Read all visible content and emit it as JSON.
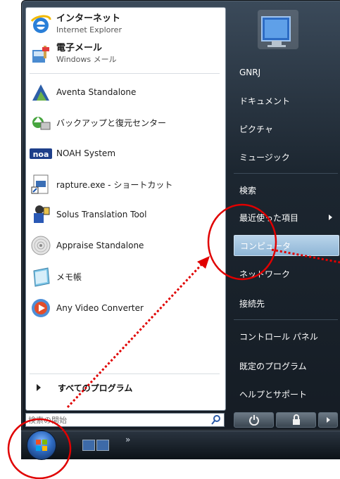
{
  "programs": [
    {
      "id": "ie",
      "main": "インターネット",
      "sub": "Internet Explorer"
    },
    {
      "id": "mail",
      "main": "電子メール",
      "sub": "Windows メール"
    },
    {
      "id": "aventa",
      "label": "Aventa Standalone"
    },
    {
      "id": "backup",
      "label": "バックアップと復元センター"
    },
    {
      "id": "noah",
      "label": "NOAH System"
    },
    {
      "id": "rapture",
      "label": "rapture.exe - ショートカット"
    },
    {
      "id": "solus",
      "label": "Solus Translation Tool"
    },
    {
      "id": "appraise",
      "label": "Appraise Standalone"
    },
    {
      "id": "notepad",
      "label": "メモ帳"
    },
    {
      "id": "avc",
      "label": "Any Video Converter"
    }
  ],
  "all_programs": "すべてのプログラム",
  "search": {
    "placeholder": "検索の開始"
  },
  "right_items": [
    {
      "id": "user",
      "label": "GNRJ"
    },
    {
      "id": "documents",
      "label": "ドキュメント"
    },
    {
      "id": "pictures",
      "label": "ピクチャ"
    },
    {
      "id": "music",
      "label": "ミュージック"
    },
    {
      "id": "search",
      "label": "検索"
    },
    {
      "id": "recent",
      "label": "最近使った項目"
    },
    {
      "id": "computer",
      "label": "コンピュータ"
    },
    {
      "id": "network",
      "label": "ネットワーク"
    },
    {
      "id": "connect",
      "label": "接続先"
    },
    {
      "id": "control",
      "label": "コントロール パネル"
    },
    {
      "id": "defaults",
      "label": "既定のプログラム"
    },
    {
      "id": "help",
      "label": "ヘルプとサポート"
    }
  ],
  "highlighted_item": "computer",
  "colors": {
    "highlight": "#9cc1e0",
    "annotation": "#e00000",
    "dotted_arrow": "#e00000"
  }
}
